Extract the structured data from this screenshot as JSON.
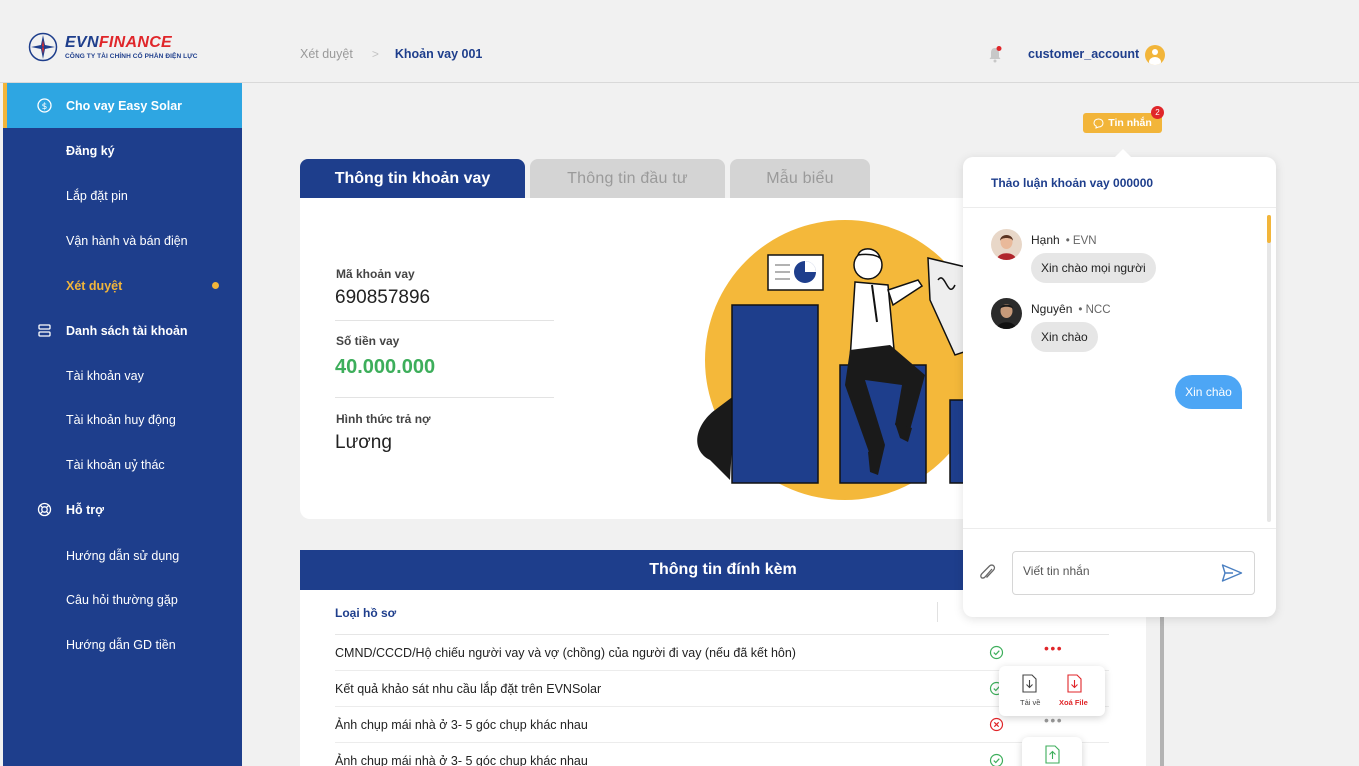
{
  "brand": {
    "name_main": "EVN",
    "name_accent": "FINANCE",
    "subtitle": "CÔNG TY TÀI CHÍNH CỔ PHẦN ĐIỆN LỰC"
  },
  "header": {
    "breadcrumb": [
      "Xét duyệt",
      "Khoản vay 001"
    ],
    "username": "customer_account"
  },
  "sidebar": {
    "items": [
      {
        "label": "Cho vay Easy Solar"
      },
      {
        "label": "Đăng ký"
      },
      {
        "label": "Lắp đặt pin"
      },
      {
        "label": "Vận hành và bán điện"
      },
      {
        "label": "Xét duyệt"
      },
      {
        "label": "Danh sách tài khoản"
      },
      {
        "label": "Tài khoản vay"
      },
      {
        "label": "Tài khoản huy động"
      },
      {
        "label": "Tài khoản uỷ thác"
      },
      {
        "label": "Hỗ trợ"
      },
      {
        "label": "Hướng dẫn sử dụng"
      },
      {
        "label": "Câu hỏi thường gặp"
      },
      {
        "label": "Hướng dẫn GD tiền"
      }
    ]
  },
  "tabs": [
    "Thông tin khoản vay",
    "Thông tin đầu tư",
    "Mẫu biểu"
  ],
  "loan": {
    "id_label": "Mã khoản vay",
    "id_value": "690857896",
    "amount_label": "Số tiền vay",
    "amount_value": "40.000.000",
    "repay_label": "Hình thức trả nợ",
    "repay_value": "Lương"
  },
  "attachments": {
    "title": "Thông tin đính kèm",
    "col_type": "Loại hồ sơ",
    "rows": [
      {
        "text": "CMND/CCCD/Hộ chiếu người vay và vợ (chồng) của người đi vay (nếu đã kết hôn)",
        "status": "ok"
      },
      {
        "text": "Kết quả khảo sát nhu cầu lắp đặt trên EVNSolar",
        "status": "ok"
      },
      {
        "text": "Ảnh chụp mái nhà ở 3- 5 góc chụp khác nhau",
        "status": "error"
      },
      {
        "text": "Ảnh chụp mái nhà ở 3- 5 góc chụp khác nhau",
        "status": "ok"
      }
    ],
    "menu": {
      "download": "Tải về",
      "delete": "Xoá File"
    }
  },
  "chat": {
    "button": "Tin nhắn",
    "badge": "2",
    "title": "Thảo luận khoản vay 000000",
    "messages": [
      {
        "name": "Hạnh",
        "org": "• EVN",
        "text": "Xin chào mọi người"
      },
      {
        "name": "Nguyên",
        "org": "• NCC",
        "text": "Xin chào"
      }
    ],
    "my_message": "Xin chào",
    "input_placeholder": "Viết tin nhắn"
  },
  "colors": {
    "primary": "#1e3e8c",
    "accent": "#f2b53a",
    "active": "#2ea6e2",
    "success": "#3dae5b",
    "danger": "#e0262a",
    "chat_bubble": "#4da6f5"
  }
}
